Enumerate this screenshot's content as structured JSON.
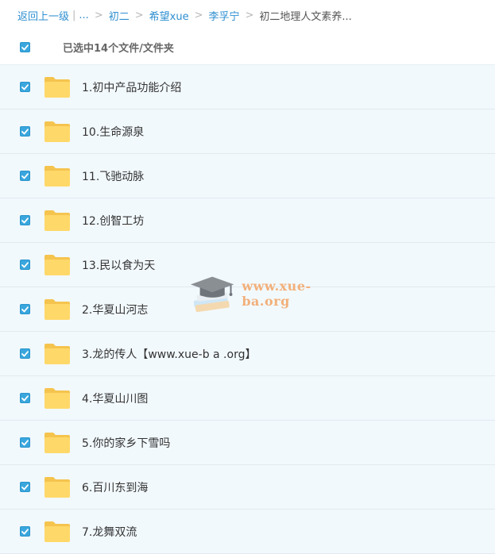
{
  "breadcrumb": {
    "back_label": "返回上一级",
    "ellipsis": "...",
    "items": [
      "初二",
      "希望xue",
      "李孚宁"
    ],
    "current": "初二地理人文素养..."
  },
  "selection": {
    "checked": true,
    "text": "已选中14个文件/文件夹"
  },
  "files": [
    {
      "name": "1.初中产品功能介绍",
      "checked": true,
      "icon": "folder-icon"
    },
    {
      "name": "10.生命源泉",
      "checked": true,
      "icon": "folder-icon"
    },
    {
      "name": "11.飞驰动脉",
      "checked": true,
      "icon": "folder-icon"
    },
    {
      "name": "12.创智工坊",
      "checked": true,
      "icon": "folder-icon"
    },
    {
      "name": "13.民以食为天",
      "checked": true,
      "icon": "folder-icon"
    },
    {
      "name": "2.华夏山河志",
      "checked": true,
      "icon": "folder-icon"
    },
    {
      "name": "3.龙的传人【www.xue-b a .org】",
      "checked": true,
      "icon": "folder-icon"
    },
    {
      "name": "4.华夏山川图",
      "checked": true,
      "icon": "folder-icon"
    },
    {
      "name": "5.你的家乡下雪吗",
      "checked": true,
      "icon": "folder-icon"
    },
    {
      "name": "6.百川东到海",
      "checked": true,
      "icon": "folder-icon"
    },
    {
      "name": "7.龙舞双流",
      "checked": true,
      "icon": "folder-icon"
    }
  ],
  "watermark": {
    "text": "www.xue-ba.org"
  },
  "colors": {
    "accent": "#2f8fd1",
    "checkbox": "#39a6dd",
    "row_background": "#f2f9fd",
    "folder": "#ffd86a",
    "watermark": "#f2b07a"
  }
}
